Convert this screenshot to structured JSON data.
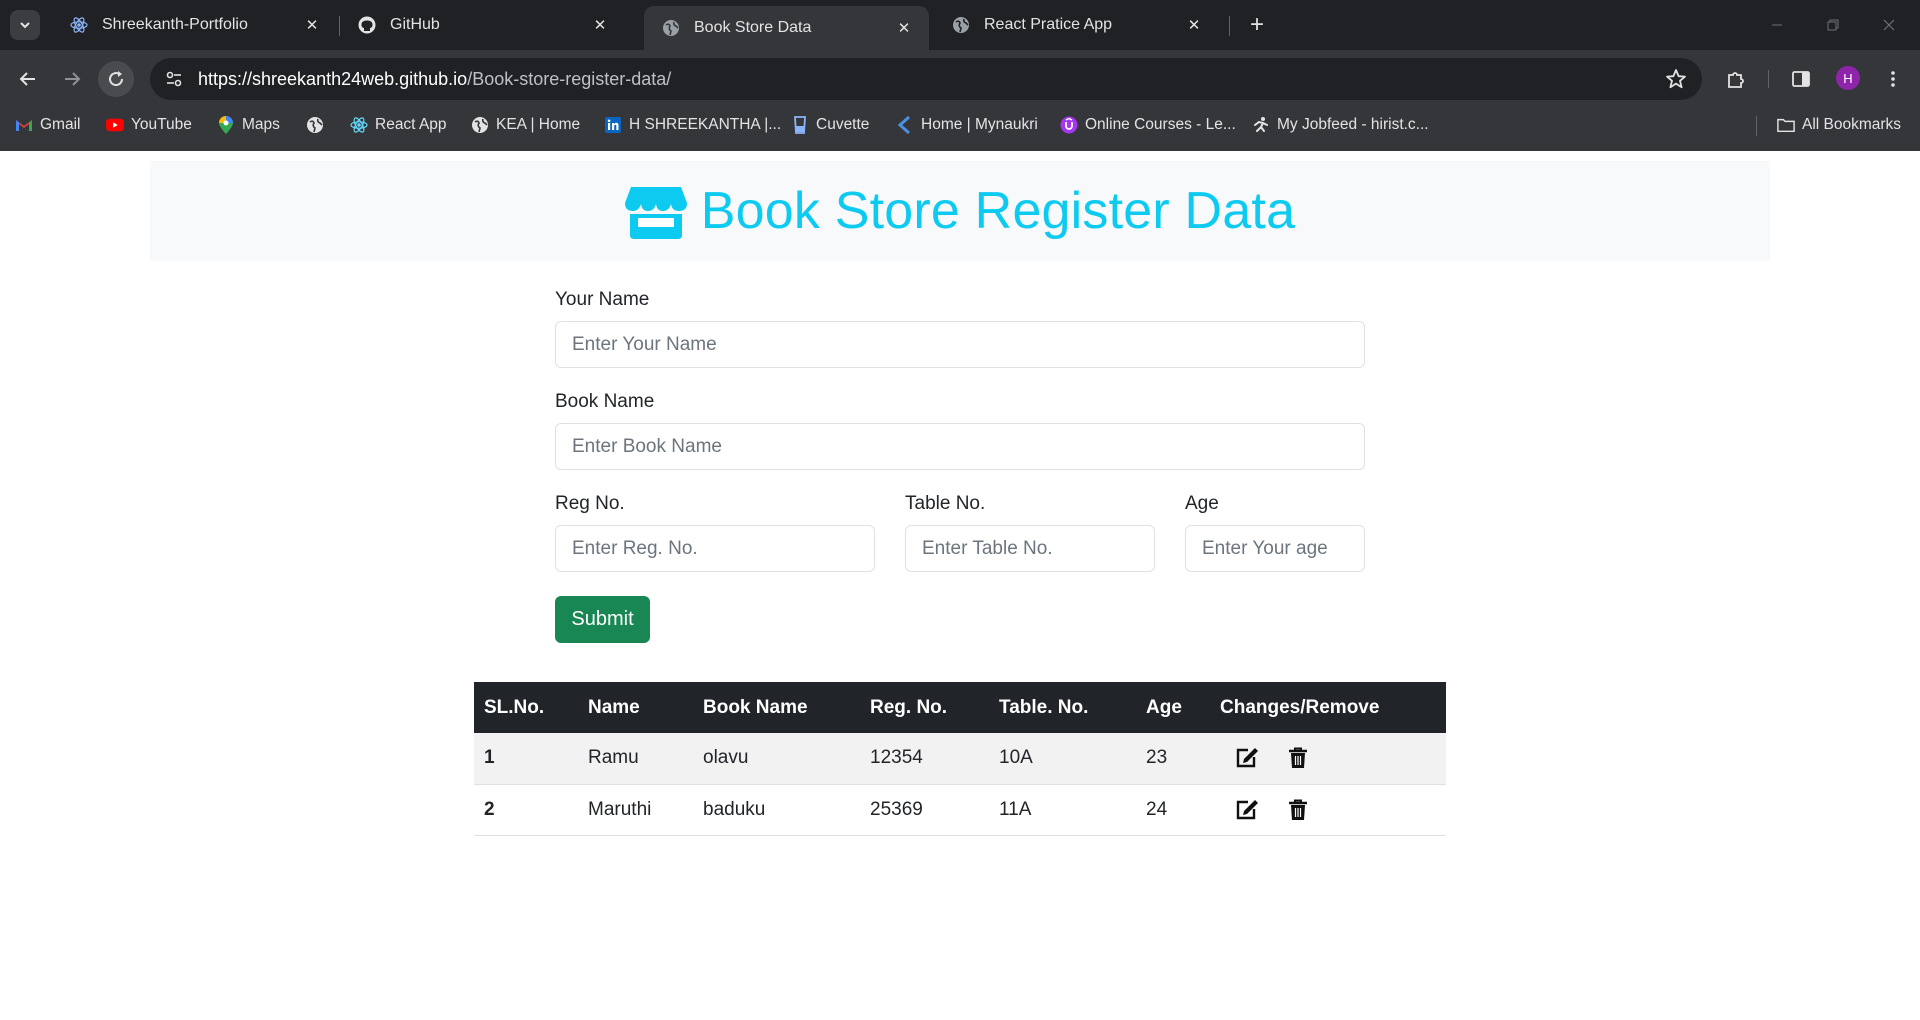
{
  "browser": {
    "tabs": [
      {
        "title": "Shreekanth-Portfolio",
        "icon": "react-icon",
        "active": false
      },
      {
        "title": "GitHub",
        "icon": "github-icon",
        "active": false
      },
      {
        "title": "Book Store Data",
        "icon": "globe-icon",
        "active": true
      },
      {
        "title": "React Pratice App",
        "icon": "globe-icon",
        "active": false
      }
    ],
    "url_host": "https://shreekanth24web.github.io",
    "url_path": "/Book-store-register-data/",
    "profile_initial": "H",
    "bookmarks": [
      {
        "label": "Gmail",
        "icon": "gmail-icon"
      },
      {
        "label": "YouTube",
        "icon": "youtube-icon"
      },
      {
        "label": "Maps",
        "icon": "maps-icon"
      },
      {
        "label": "",
        "icon": "globe-icon"
      },
      {
        "label": "React App",
        "icon": "react-icon"
      },
      {
        "label": "KEA | Home",
        "icon": "globe-icon"
      },
      {
        "label": "H SHREEKANTHA |...",
        "icon": "linkedin-icon"
      },
      {
        "label": "Cuvette",
        "icon": "cuvette-icon"
      },
      {
        "label": "Home | Mynaukri",
        "icon": "mynaukri-icon"
      },
      {
        "label": "Online Courses - Le...",
        "icon": "udemy-icon"
      },
      {
        "label": "My Jobfeed - hirist.c...",
        "icon": "hirist-icon"
      }
    ],
    "all_bookmarks": "All Bookmarks"
  },
  "page": {
    "title": "Book Store Register Data",
    "title_icon": "store-icon",
    "accent_color": "#0dcaf0",
    "form": {
      "name_label": "Your Name",
      "name_placeholder": "Enter Your Name",
      "book_label": "Book Name",
      "book_placeholder": "Enter Book Name",
      "reg_label": "Reg No.",
      "reg_placeholder": "Enter Reg. No.",
      "table_label": "Table No.",
      "table_placeholder": "Enter Table No.",
      "age_label": "Age",
      "age_placeholder": "Enter Your age",
      "submit_label": "Submit",
      "submit_color": "#198754"
    },
    "table": {
      "headers": [
        "SL.No.",
        "Name",
        "Book Name",
        "Reg. No.",
        "Table. No.",
        "Age",
        "Changes/Remove"
      ],
      "rows": [
        {
          "sl": "1",
          "name": "Ramu",
          "book": "olavu",
          "reg": "12354",
          "table": "10A",
          "age": "23"
        },
        {
          "sl": "2",
          "name": "Maruthi",
          "book": "baduku",
          "reg": "25369",
          "table": "11A",
          "age": "24"
        }
      ]
    }
  }
}
